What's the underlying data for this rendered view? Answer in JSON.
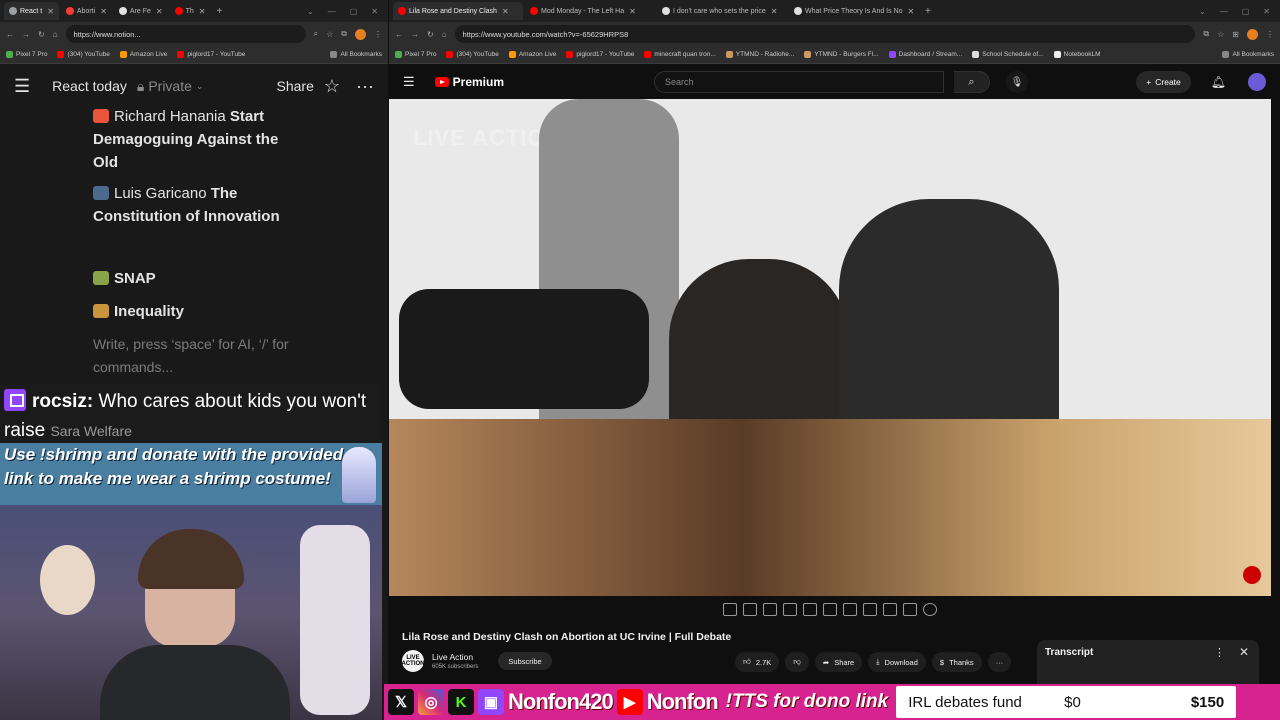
{
  "left": {
    "tabs": [
      {
        "label": "React t",
        "active": true,
        "color": "#9aa0a6"
      },
      {
        "label": "Aborti",
        "active": false,
        "color": "#ff3b30"
      },
      {
        "label": "Are Fe",
        "active": false,
        "color": "#e0e0e0"
      },
      {
        "label": "Th",
        "active": false,
        "color": "#ff0000"
      }
    ],
    "url": "https://www.notion...",
    "bookmarks": [
      "Pixel 7 Pro",
      "(304) YouTube",
      "Amazon Live",
      "piglord17 - YouTube",
      "All Bookmarks"
    ],
    "notion": {
      "title": "React today",
      "privacy": "Private",
      "share": "Share",
      "items": [
        {
          "author": "Richard Hanania",
          "title": "Start Demagoguing Against the Old",
          "icon_color": "#e8553b"
        },
        {
          "author": "Luis Garicano",
          "title": "The Constitution of Innovation",
          "icon_color": "#4b6a8c"
        },
        {
          "label": "SNAP",
          "icon_color": "#8aa34a"
        },
        {
          "label": "Inequality",
          "icon_color": "#c8953c"
        }
      ],
      "placeholder": "Write, press ‘space’ for AI, ‘/’ for commands..."
    },
    "chat": {
      "username": "rocsiz:",
      "message": "Who cares about kids you won't raise",
      "subtext": "Sara Welfare"
    },
    "shrimp_text": "Use !shrimp and donate with the provided link to make me wear a shrimp costume!"
  },
  "right": {
    "tabs": [
      {
        "label": "Lila Rose and Destiny Clash",
        "active": true,
        "color": "#ff0000"
      },
      {
        "label": "Mod Monday - The Left Ha",
        "active": false,
        "color": "#ff0000"
      },
      {
        "label": "I don't care who sets the price",
        "active": false,
        "color": "#e0e0e0"
      },
      {
        "label": "What Price Theory Is And Is No",
        "active": false,
        "color": "#e0e0e0"
      }
    ],
    "url": "https://www.youtube.com/watch?v=-65629HRPS8",
    "bookmarks": [
      "Pixel 7 Pro",
      "(304) YouTube",
      "Amazon Live",
      "piglord17 - YouTube",
      "minecraft quan tron...",
      "YTMND - Radiohe...",
      "YTMND - Burgers Fl...",
      "Dashboard / Stream...",
      "School Schedule of...",
      "NotebookLM",
      "All Bookmarks"
    ],
    "youtube": {
      "logo": "Premium",
      "search_placeholder": "Search",
      "create": "Create",
      "video_watermark": "LIVE ACTION",
      "video_title": "Lila Rose and Destiny Clash on Abortion at UC Irvine | Full Debate",
      "channel": "Live Action",
      "channel_avatar": "LIVE ACTION",
      "subscribers": "605K subscribers",
      "subscribe": "Subscribe",
      "likes": "2.7K",
      "share": "Share",
      "download": "Download",
      "thanks": "Thanks",
      "transcript": "Transcript"
    }
  },
  "banner": {
    "name1": "Nonfon420",
    "name2": "Nonfon",
    "tts": "!TTS for dono link",
    "fund_label": "IRL debates fund",
    "fund_current": "$0",
    "fund_goal": "$150"
  },
  "colors": {
    "youtube_red": "#ff0000",
    "twitch_purple": "#9146ff",
    "banner_pink": "#d6238f"
  }
}
